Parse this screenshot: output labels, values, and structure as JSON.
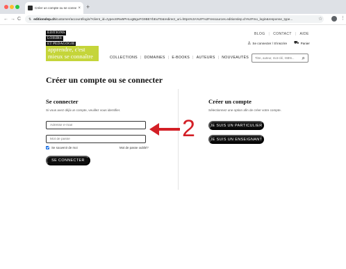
{
  "browser": {
    "tab_title": "Créer un compte ou se conne...",
    "tab_close": "×",
    "new_tab": "+",
    "nav_back": "←",
    "nav_forward": "→",
    "nav_reload": "C",
    "url_host": "editionslep.ch",
    "url_path": "/customer/account/login/?client_id=zypeoSRw5PHLvgBguFG9BEYbEuTE&redirect_uri=https%3A%2F%2Fressources.editionslep.ch%2Fmo_login&response_type...",
    "star": "☆",
    "menu": "⋮"
  },
  "site": {
    "logo_lines": [
      "ÉDITIONS",
      "LOISIRS",
      "ET PÉDAGOGIE"
    ],
    "tagline_lines": [
      "apprendre, c'est",
      "mieux se connaître"
    ],
    "top_links": [
      "BLOG",
      "CONTACT",
      "AIDE"
    ],
    "account_label": "Se connecter / S'inscrire",
    "cart_label": "Panier",
    "nav_items": [
      "COLLECTIONS",
      "DOMAINES",
      "E-BOOKS",
      "AUTEURS",
      "NOUVEAUTÉS"
    ],
    "search_placeholder": "Titre, auteur, mot-clé, ISBN..."
  },
  "page": {
    "title": "Créer un compte ou se connecter",
    "login": {
      "heading": "Se connecter",
      "intro": "Si vous avez déjà un compte, veuillez vous identifier.",
      "email_placeholder": "Adresse e-mail",
      "password_placeholder": "Mot de passe",
      "remember_label": "Se souvenir de moi",
      "remember_checked": true,
      "forgot_label": "Mot de passe oublié?",
      "submit_label": "SE CONNECTER"
    },
    "create": {
      "heading": "Créer un compte",
      "intro": "Sélectionnez une option afin de créer votre compte.",
      "btn_particulier": "JE SUIS UN PARTICULIER",
      "btn_enseignant": "JE SUIS UN ENSEIGNANT"
    }
  },
  "annotation": {
    "number": "2",
    "color": "#d31f26"
  },
  "colors": {
    "tagline_bg": "#c5d53a",
    "button_bg": "#0d0d0d",
    "checkbox": "#1a6fe3"
  }
}
